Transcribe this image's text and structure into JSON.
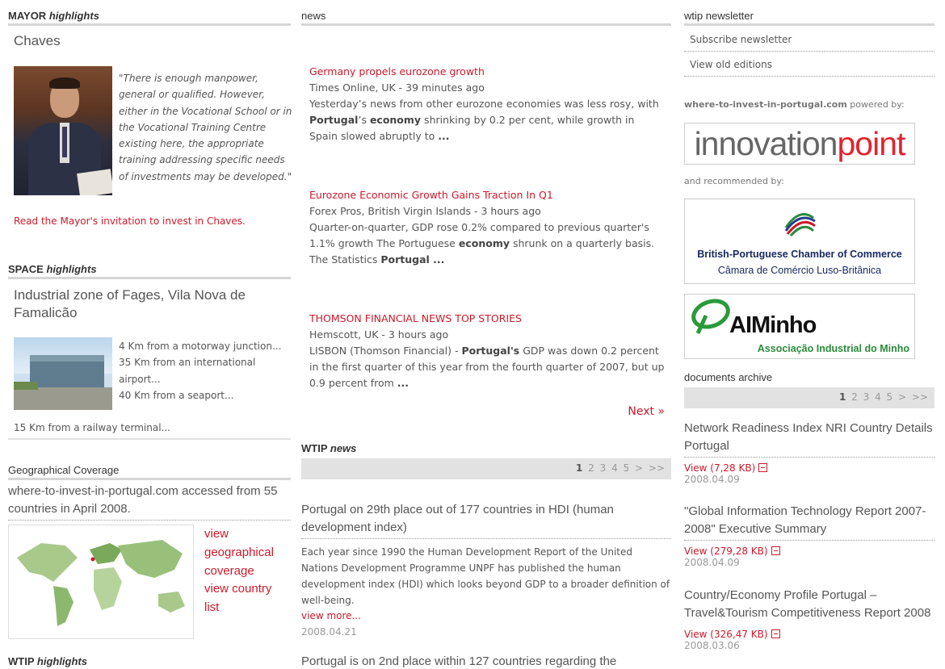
{
  "mayor": {
    "title_a": "MAYOR",
    "title_b": "highlights",
    "city": "Chaves",
    "quote": "\"There is enough manpower, general or qualified. However, either in the Vocational School or in the Vocational Training Centre existing here, the appropriate training addressing specific needs of investments may be developed.\"",
    "link": "Read the Mayor's invitation to invest in Chaves."
  },
  "space": {
    "title_a": "SPACE",
    "title_b": "highlights",
    "zone": "Industrial zone of Fages, Vila Nova de Famalicão",
    "facts": [
      "4 Km from a motorway junction...",
      "35 Km from an international airport...",
      "40 Km from a seaport...",
      "15 Km from a railway terminal..."
    ]
  },
  "geo": {
    "title": "Geographical Coverage",
    "text": "where-to-invest-in-portugal.com accessed from 55 countries in April 2008.",
    "link1": "view geographical coverage",
    "link2": "view country list"
  },
  "wtip_highlights": {
    "title_a": "WTIP",
    "title_b": "highlights"
  },
  "news": {
    "title": "news",
    "items": [
      {
        "title": "Germany propels eurozone growth",
        "source": "Times Online, UK - 39 minutes ago"
      },
      {
        "title": "Eurozone Economic Growth Gains Traction In Q1",
        "source": "Forex Pros, British Virgin Islands - 3 hours ago"
      },
      {
        "title": "THOMSON FINANCIAL NEWS TOP STORIES",
        "source": "Hemscott, UK - 3 hours ago"
      }
    ],
    "next": "Next »"
  },
  "wtip_news": {
    "title_a": "WTIP",
    "title_b": "news",
    "pages": [
      "1",
      "2",
      "3",
      "4",
      "5",
      ">",
      ">>"
    ],
    "item1_title": "Portugal on 29th place out of 177 countries in HDI (human development index)",
    "item1_body": "Each year since 1990 the Human Development Report of the United Nations Development Programme UNPF has published the human development index (HDI) which looks beyond GDP to a broader definition of well-being.",
    "item1_more": "view more...",
    "item1_date": "2008.04.21",
    "item2_title": "Portugal is on 2nd place within 127 countries regarding the"
  },
  "newsletter": {
    "title": "wtip newsletter",
    "subscribe": "Subscribe newsletter",
    "old": "View old editions",
    "powered_site": "where-to-invest-in-portugal.com",
    "powered_by": "powered by:",
    "logo1_a": "innovation",
    "logo1_b": "point",
    "recommended": "and recommended by:",
    "logo2_line1": "British-Portuguese Chamber of Commerce",
    "logo2_line2": "Câmara de Comércio Luso-Britânica",
    "logo3_name": "AIMinho",
    "logo3_sub": "Associação Industrial do Minho"
  },
  "docs": {
    "title": "documents archive",
    "pages": [
      "1",
      "2",
      "3",
      "4",
      "5",
      ">",
      ">>"
    ],
    "items": [
      {
        "title": "Network Readiness Index NRI Country Details Portugal",
        "view": "View (7,28 KB)",
        "date": "2008.04.09"
      },
      {
        "title": "\"Global Information Technology Report 2007-2008\" Executive Summary",
        "view": "View (279,28 KB)",
        "date": "2008.04.09"
      },
      {
        "title": "Country/Economy Profile Portugal – Travel&Tourism Competitiveness Report 2008",
        "view": "View (326,47 KB)",
        "date": "2008.03.06"
      }
    ]
  },
  "colors": {
    "accent": "#cc1a2b",
    "pager_bg": "#e2e2e2"
  }
}
